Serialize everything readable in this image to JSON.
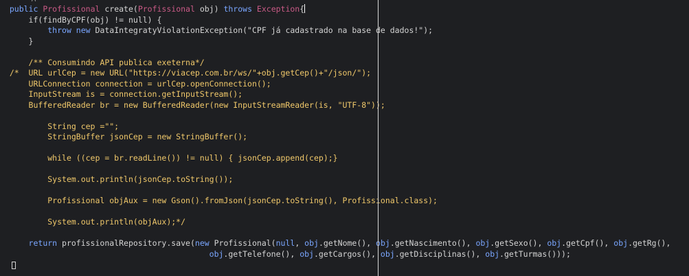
{
  "editor": {
    "colors": {
      "background": "#1e1f22",
      "default": "#d4d4d4",
      "keyword": "#7aa6ff",
      "type": "#c95a86",
      "string": "#d4d4d4",
      "comment": "#f0c86a",
      "guide": "#d9d9d9"
    },
    "lines": [
      {
        "indent": 2,
        "tokens": [
          {
            "t": "public ",
            "c": "keyword"
          },
          {
            "t": "Profissional ",
            "c": "type"
          },
          {
            "t": "create(",
            "c": "default"
          },
          {
            "t": "Profissional ",
            "c": "type"
          },
          {
            "t": "obj) ",
            "c": "default"
          },
          {
            "t": "throws ",
            "c": "keyword"
          },
          {
            "t": "Exception",
            "c": "type"
          },
          {
            "t": "{",
            "c": "default"
          },
          {
            "caret": true
          }
        ]
      },
      {
        "indent": 6,
        "tokens": [
          {
            "t": "if(findByCPF(obj) != null) {",
            "c": "default"
          }
        ]
      },
      {
        "indent": 10,
        "tokens": [
          {
            "t": "throw new ",
            "c": "keyword"
          },
          {
            "t": "DataIntegratyViolationException(\"CPF já cadastrado na base de dados!\");",
            "c": "default"
          }
        ]
      },
      {
        "indent": 6,
        "tokens": [
          {
            "t": "}",
            "c": "default"
          }
        ]
      },
      {
        "indent": 0,
        "tokens": []
      },
      {
        "indent": 6,
        "tokens": [
          {
            "t": "/** Consumindo API publica exeterna*/",
            "c": "comment"
          }
        ]
      },
      {
        "indent": 2,
        "tokens": [
          {
            "t": "/*  URL urlCep = new URL(\"https://viacep.com.br/ws/\"+obj.getCep()+\"/json/\");",
            "c": "comment"
          }
        ]
      },
      {
        "indent": 6,
        "tokens": [
          {
            "t": "URLConnection connection = urlCep.openConnection();",
            "c": "comment"
          }
        ]
      },
      {
        "indent": 6,
        "tokens": [
          {
            "t": "InputStream is = connection.getInputStream();",
            "c": "comment"
          }
        ]
      },
      {
        "indent": 6,
        "tokens": [
          {
            "t": "BufferedReader br = new BufferedReader(new InputStreamReader(is, \"UTF-8\"));",
            "c": "comment"
          }
        ]
      },
      {
        "indent": 0,
        "tokens": []
      },
      {
        "indent": 10,
        "tokens": [
          {
            "t": "String cep =\"\";",
            "c": "comment"
          }
        ]
      },
      {
        "indent": 10,
        "tokens": [
          {
            "t": "StringBuffer jsonCep = new StringBuffer();",
            "c": "comment"
          }
        ]
      },
      {
        "indent": 0,
        "tokens": []
      },
      {
        "indent": 10,
        "tokens": [
          {
            "t": "while ((cep = br.readLine()) != null) { jsonCep.append(cep);}",
            "c": "comment"
          }
        ]
      },
      {
        "indent": 0,
        "tokens": []
      },
      {
        "indent": 10,
        "tokens": [
          {
            "t": "System.out.println(jsonCep.toString());",
            "c": "comment"
          }
        ]
      },
      {
        "indent": 0,
        "tokens": []
      },
      {
        "indent": 10,
        "tokens": [
          {
            "t": "Profissional objAux = new Gson().fromJson(jsonCep.toString(), Profissional.class);",
            "c": "comment"
          }
        ]
      },
      {
        "indent": 0,
        "tokens": []
      },
      {
        "indent": 10,
        "tokens": [
          {
            "t": "System.out.println(objAux);*/",
            "c": "comment"
          }
        ]
      },
      {
        "indent": 0,
        "tokens": []
      },
      {
        "indent": 6,
        "tokens": [
          {
            "t": "return ",
            "c": "keyword"
          },
          {
            "t": "profissionalRepository.save(",
            "c": "default"
          },
          {
            "t": "new ",
            "c": "keyword"
          },
          {
            "t": "Profissional(",
            "c": "default"
          },
          {
            "t": "null",
            "c": "keyword"
          },
          {
            "t": ", ",
            "c": "default"
          },
          {
            "t": "obj",
            "c": "keyword"
          },
          {
            "t": ".getNome(), ",
            "c": "default"
          },
          {
            "t": "obj",
            "c": "keyword"
          },
          {
            "t": ".getNascimento(), ",
            "c": "default"
          },
          {
            "t": "obj",
            "c": "keyword"
          },
          {
            "t": ".getSexo(), ",
            "c": "default"
          },
          {
            "t": "obj",
            "c": "keyword"
          },
          {
            "t": ".getCpf(), ",
            "c": "default"
          },
          {
            "t": "obj",
            "c": "keyword"
          },
          {
            "t": ".getRg(),",
            "c": "default"
          }
        ]
      },
      {
        "indent": 44,
        "tokens": [
          {
            "t": "obj",
            "c": "keyword"
          },
          {
            "t": ".getTelefone(), ",
            "c": "default"
          },
          {
            "t": "obj",
            "c": "keyword"
          },
          {
            "t": ".getCargos(), ",
            "c": "default"
          },
          {
            "t": "obj",
            "c": "keyword"
          },
          {
            "t": ".getDisciplinas(), ",
            "c": "default"
          },
          {
            "t": "obj",
            "c": "keyword"
          },
          {
            "t": ".getTurmas()));",
            "c": "default"
          }
        ]
      }
    ]
  }
}
